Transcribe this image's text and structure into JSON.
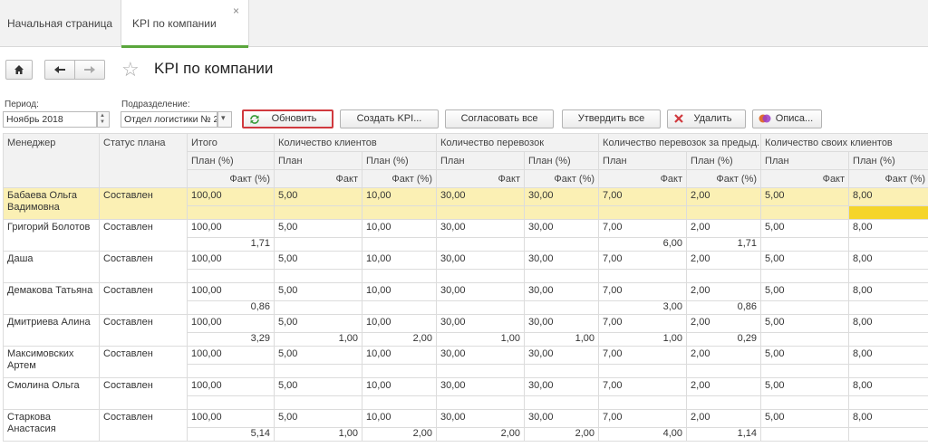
{
  "tabs": [
    {
      "label": "Начальная страница"
    },
    {
      "label": "KPI по компании",
      "close": "×"
    }
  ],
  "page_title": "KPI по компании",
  "filters": {
    "period_label": "Период:",
    "period_value": "Ноябрь 2018",
    "division_label": "Подразделение:",
    "division_value": "Отдел логистики № 2"
  },
  "buttons": {
    "refresh": "Обновить",
    "create_kpi": "Создать KPI...",
    "approve_all": "Согласовать все",
    "confirm_all": "Утвердить все",
    "delete": "Удалить",
    "description": "Описа..."
  },
  "table": {
    "col_manager": "Менеджер",
    "col_status": "Статус плана",
    "groups": [
      {
        "name": "Итого",
        "sub": [
          "План (%)",
          "Факт (%)"
        ]
      },
      {
        "name": "Количество клиентов",
        "sub": [
          "План",
          "План (%)",
          "Факт",
          "Факт (%)"
        ]
      },
      {
        "name": "Количество перевозок",
        "sub": [
          "План",
          "План (%)",
          "Факт",
          "Факт (%)"
        ]
      },
      {
        "name": "Количество перевозок за предыд...",
        "sub": [
          "План",
          "План (%)",
          "Факт",
          "Факт (%)"
        ]
      },
      {
        "name": "Количество своих клиентов",
        "sub": [
          "План",
          "План (%)",
          "Факт",
          "Факт (%)"
        ]
      }
    ],
    "rows": [
      {
        "name": "Бабаева Ольга Вадимовна",
        "status": "Составлен",
        "plan": [
          "100,00",
          "5,00",
          "10,00",
          "30,00",
          "30,00",
          "7,00",
          "2,00",
          "5,00",
          "8,00"
        ],
        "fact": [
          "",
          "",
          "",
          "",
          "",
          "",
          "",
          "",
          ""
        ]
      },
      {
        "name": "Григорий Болотов",
        "status": "Составлен",
        "plan": [
          "100,00",
          "5,00",
          "10,00",
          "30,00",
          "30,00",
          "7,00",
          "2,00",
          "5,00",
          "8,00"
        ],
        "fact": [
          "1,71",
          "",
          "",
          "",
          "",
          "6,00",
          "1,71",
          "",
          ""
        ]
      },
      {
        "name": "Даша",
        "status": "Составлен",
        "plan": [
          "100,00",
          "5,00",
          "10,00",
          "30,00",
          "30,00",
          "7,00",
          "2,00",
          "5,00",
          "8,00"
        ],
        "fact": [
          "",
          "",
          "",
          "",
          "",
          "",
          "",
          "",
          ""
        ]
      },
      {
        "name": "Демакова Татьяна",
        "status": "Составлен",
        "plan": [
          "100,00",
          "5,00",
          "10,00",
          "30,00",
          "30,00",
          "7,00",
          "2,00",
          "5,00",
          "8,00"
        ],
        "fact": [
          "0,86",
          "",
          "",
          "",
          "",
          "3,00",
          "0,86",
          "",
          ""
        ]
      },
      {
        "name": "Дмитриева Алина",
        "status": "Составлен",
        "plan": [
          "100,00",
          "5,00",
          "10,00",
          "30,00",
          "30,00",
          "7,00",
          "2,00",
          "5,00",
          "8,00"
        ],
        "fact": [
          "3,29",
          "1,00",
          "2,00",
          "1,00",
          "1,00",
          "1,00",
          "0,29",
          "",
          ""
        ]
      },
      {
        "name": "Максимовских Артем",
        "status": "Составлен",
        "plan": [
          "100,00",
          "5,00",
          "10,00",
          "30,00",
          "30,00",
          "7,00",
          "2,00",
          "5,00",
          "8,00"
        ],
        "fact": [
          "",
          "",
          "",
          "",
          "",
          "",
          "",
          "",
          ""
        ]
      },
      {
        "name": "Смолина Ольга",
        "status": "Составлен",
        "plan": [
          "100,00",
          "5,00",
          "10,00",
          "30,00",
          "30,00",
          "7,00",
          "2,00",
          "5,00",
          "8,00"
        ],
        "fact": [
          "",
          "",
          "",
          "",
          "",
          "",
          "",
          "",
          ""
        ]
      },
      {
        "name": "Старкова Анастасия",
        "status": "Составлен",
        "plan": [
          "100,00",
          "5,00",
          "10,00",
          "30,00",
          "30,00",
          "7,00",
          "2,00",
          "5,00",
          "8,00"
        ],
        "fact": [
          "5,14",
          "1,00",
          "2,00",
          "2,00",
          "2,00",
          "4,00",
          "1,14",
          "",
          ""
        ]
      }
    ]
  },
  "colors": {
    "accent_green": "#5aa63c",
    "selected_row": "#fbf0b4",
    "highlight_cell": "#f5d52a",
    "primary_border": "#d0393e"
  }
}
